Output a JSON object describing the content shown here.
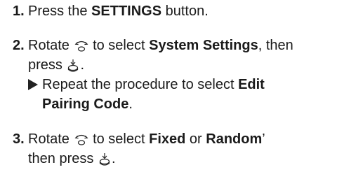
{
  "steps": [
    {
      "number": "1.",
      "pre": "Press the ",
      "bold": "SETTINGS",
      "post": " button."
    },
    {
      "number": "2.",
      "rotate": "Rotate",
      "to_select": "to select",
      "bold": "System Settings",
      "then": ", then",
      "press": "press",
      "press_end": ".",
      "sub_pre": "Repeat the procedure to select ",
      "sub_bold_1": "Edit",
      "sub_bold_2": "Pairing Code",
      "sub_end": "."
    },
    {
      "number": "3.",
      "rotate": "Rotate",
      "to_select": "to select",
      "bold1": "Fixed",
      "or": " or ",
      "bold2": "Random",
      "apostrophe": "’",
      "then_press": "then press",
      "end": "."
    }
  ],
  "icons": {
    "dial": "interface-dial-rotate-icon",
    "press": "interface-dial-press-icon",
    "arrow": "triangle-right-icon"
  }
}
